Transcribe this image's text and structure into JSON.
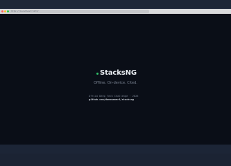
{
  "browser": {
    "address": "http://localhost:5173/",
    "traffic_lights": [
      "#ff5f57",
      "#febc2e",
      "#28c840"
    ]
  },
  "app": {
    "brand_name": "StacksNG",
    "brand_dot_color": "#31c46a",
    "tagline": "Offline. On-device. Cited.",
    "credit_line": "Africa Deep Tech Challenge · 2026",
    "repo_link": "github.com/danowaneri/stacksng"
  }
}
